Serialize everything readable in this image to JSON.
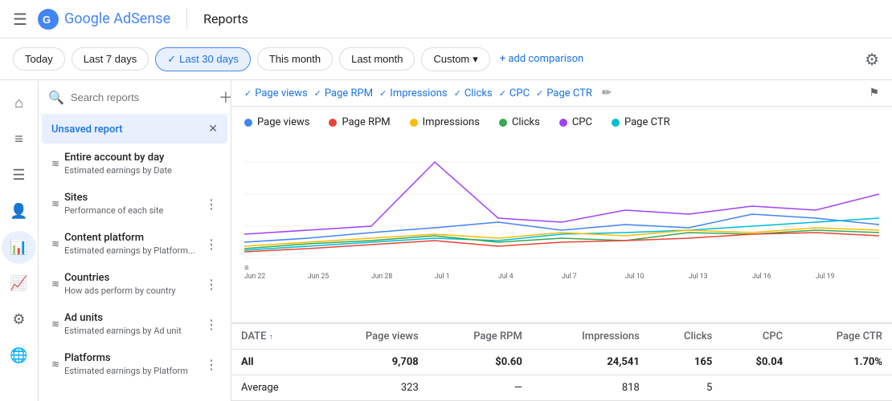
{
  "header": {
    "menu_icon": "☰",
    "logo_text": "Google AdSense",
    "title": "Reports",
    "settings_icon": "⚙"
  },
  "date_filter": {
    "buttons": [
      {
        "label": "Today",
        "active": false
      },
      {
        "label": "Last 7 days",
        "active": false
      },
      {
        "label": "Last 30 days",
        "active": true
      },
      {
        "label": "This month",
        "active": false
      },
      {
        "label": "Last month",
        "active": false
      }
    ],
    "custom_label": "Custom",
    "add_comparison_label": "+ add comparison"
  },
  "sidebar": {
    "search_placeholder": "Search reports",
    "items": [
      {
        "label": "Unsaved report",
        "sub": "",
        "active": true
      },
      {
        "label": "Entire account by day",
        "sub": "Estimated earnings by Date",
        "active": false
      },
      {
        "label": "Sites",
        "sub": "Performance of each site",
        "active": false
      },
      {
        "label": "Content platform",
        "sub": "Estimated earnings by Platform...",
        "active": false
      },
      {
        "label": "Countries",
        "sub": "How ads perform by country",
        "active": false
      },
      {
        "label": "Ad units",
        "sub": "Estimated earnings by Ad unit",
        "active": false
      },
      {
        "label": "Platforms",
        "sub": "Estimated earnings by Platform",
        "active": false
      }
    ]
  },
  "chips": [
    {
      "label": "Page views"
    },
    {
      "label": "Page RPM"
    },
    {
      "label": "Impressions"
    },
    {
      "label": "Clicks"
    },
    {
      "label": "CPC"
    },
    {
      "label": "Page CTR"
    }
  ],
  "legend": [
    {
      "label": "Page views",
      "color": "#4285f4"
    },
    {
      "label": "Page RPM",
      "color": "#ea4335"
    },
    {
      "label": "Impressions",
      "color": "#fbbc04"
    },
    {
      "label": "Clicks",
      "color": "#34a853"
    },
    {
      "label": "CPC",
      "color": "#a142f4"
    },
    {
      "label": "Page CTR",
      "color": "#00bcd4"
    }
  ],
  "chart": {
    "x_labels": [
      "Jun 22",
      "Jun 25",
      "Jun 28",
      "Jul 1",
      "Jul 4",
      "Jul 7",
      "Jul 10",
      "Jul 13",
      "Jul 16",
      "Jul 19"
    ]
  },
  "table": {
    "columns": [
      {
        "label": "DATE",
        "sort": true
      },
      {
        "label": "Page views"
      },
      {
        "label": "Page RPM"
      },
      {
        "label": "Impressions"
      },
      {
        "label": "Clicks"
      },
      {
        "label": "CPC"
      },
      {
        "label": "Page CTR"
      }
    ],
    "rows": [
      {
        "date": "All",
        "page_views": "9,708",
        "page_rpm": "$0.60",
        "impressions": "24,541",
        "clicks": "165",
        "cpc": "$0.04",
        "page_ctr": "1.70%",
        "is_all": true
      },
      {
        "date": "Average",
        "page_views": "323",
        "page_rpm": "—",
        "impressions": "818",
        "clicks": "5",
        "cpc": "",
        "page_ctr": "",
        "is_all": false
      }
    ]
  },
  "left_nav": {
    "icons": [
      "⊞",
      "≡",
      "☰",
      "👤",
      "📊",
      "📈",
      "⚙",
      "🌐"
    ]
  }
}
